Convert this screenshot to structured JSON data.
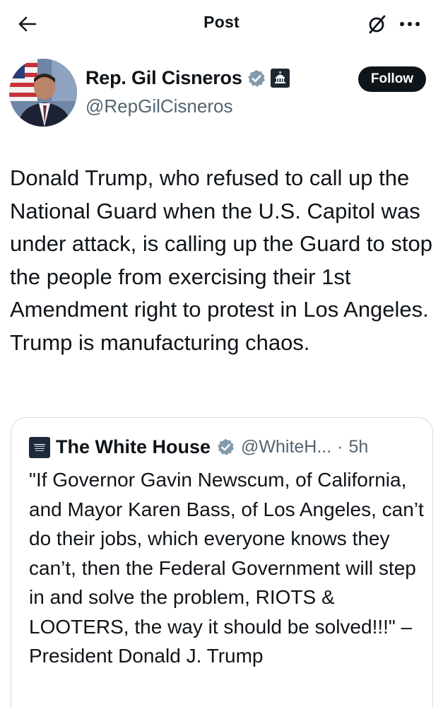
{
  "topbar": {
    "title": "Post",
    "icons": [
      "back-arrow-icon",
      "grok-icon",
      "more-icon"
    ]
  },
  "author": {
    "name": "Rep. Gil Cisneros",
    "handle": "@RepGilCisneros",
    "follow_label": "Follow",
    "verified_color": "#829aab",
    "badges": [
      "verified-badge-icon",
      "government-badge-icon"
    ]
  },
  "post": {
    "text": "Donald Trump, who refused to call up the National Guard when the U.S. Capitol was under attack, is calling up the Guard to stop the people from exercising their 1st Amendment right to protest in Los Angeles. Trump is manufacturing chaos."
  },
  "quote": {
    "name": "The White House",
    "handle": "@WhiteH...",
    "separator": "·",
    "time": "5h",
    "text": "\"If Governor Gavin Newscum, of California, and Mayor Karen Bass, of Los Angeles, can’t do their jobs, which everyone knows they can’t, then the Federal Government will step in and solve the problem, RIOTS & LOOTERS, the way it should be solved!!!\" – President Donald J. Trump"
  },
  "colors": {
    "text": "#0f1419",
    "secondary": "#536471",
    "border": "#cfd9de",
    "button_bg": "#0f1419"
  }
}
